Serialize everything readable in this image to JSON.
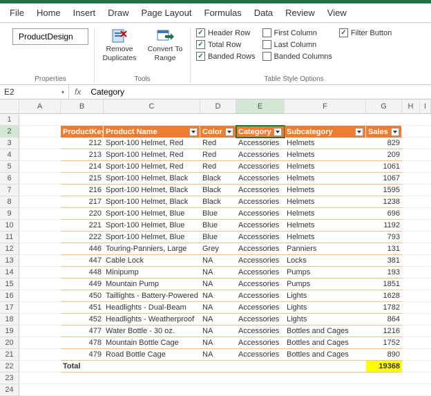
{
  "menu": [
    "File",
    "Home",
    "Insert",
    "Draw",
    "Page Layout",
    "Formulas",
    "Data",
    "Review",
    "View"
  ],
  "ribbon": {
    "tableName": "ProductDesign",
    "propertiesLabel": "Properties",
    "toolsLabel": "Tools",
    "tableStyleLabel": "Table Style Options",
    "removeDup": "Remove Duplicates",
    "convertRange": "Convert To Range",
    "opts": {
      "headerRow": "Header Row",
      "totalRow": "Total Row",
      "bandedRows": "Banded Rows",
      "firstCol": "First Column",
      "lastCol": "Last Column",
      "bandedCols": "Banded Columns",
      "filterBtn": "Filter Button"
    }
  },
  "nameBox": "E2",
  "formulaBar": "Category",
  "colHeaders": [
    "A",
    "B",
    "C",
    "D",
    "E",
    "F",
    "G",
    "H",
    "I"
  ],
  "rowHeaders": [
    "1",
    "2",
    "3",
    "4",
    "5",
    "6",
    "7",
    "8",
    "9",
    "10",
    "11",
    "12",
    "13",
    "14",
    "15",
    "16",
    "17",
    "18",
    "19",
    "20",
    "21",
    "22",
    "23",
    "24"
  ],
  "tableHeaders": [
    "ProductKey",
    "Product Name",
    "Color",
    "Category",
    "Subcategory",
    "Sales"
  ],
  "rows": [
    {
      "key": "212",
      "name": "Sport-100 Helmet, Red",
      "color": "Red",
      "cat": "Accessories",
      "sub": "Helmets",
      "sales": "829"
    },
    {
      "key": "213",
      "name": "Sport-100 Helmet, Red",
      "color": "Red",
      "cat": "Accessories",
      "sub": "Helmets",
      "sales": "209"
    },
    {
      "key": "214",
      "name": "Sport-100 Helmet, Red",
      "color": "Red",
      "cat": "Accessories",
      "sub": "Helmets",
      "sales": "1061"
    },
    {
      "key": "215",
      "name": "Sport-100 Helmet, Black",
      "color": "Black",
      "cat": "Accessories",
      "sub": "Helmets",
      "sales": "1067"
    },
    {
      "key": "216",
      "name": "Sport-100 Helmet, Black",
      "color": "Black",
      "cat": "Accessories",
      "sub": "Helmets",
      "sales": "1595"
    },
    {
      "key": "217",
      "name": "Sport-100 Helmet, Black",
      "color": "Black",
      "cat": "Accessories",
      "sub": "Helmets",
      "sales": "1238"
    },
    {
      "key": "220",
      "name": "Sport-100 Helmet, Blue",
      "color": "Blue",
      "cat": "Accessories",
      "sub": "Helmets",
      "sales": "696"
    },
    {
      "key": "221",
      "name": "Sport-100 Helmet, Blue",
      "color": "Blue",
      "cat": "Accessories",
      "sub": "Helmets",
      "sales": "1192"
    },
    {
      "key": "222",
      "name": "Sport-100 Helmet, Blue",
      "color": "Blue",
      "cat": "Accessories",
      "sub": "Helmets",
      "sales": "793"
    },
    {
      "key": "446",
      "name": "Touring-Panniers, Large",
      "color": "Grey",
      "cat": "Accessories",
      "sub": "Panniers",
      "sales": "131"
    },
    {
      "key": "447",
      "name": "Cable Lock",
      "color": "NA",
      "cat": "Accessories",
      "sub": "Locks",
      "sales": "381"
    },
    {
      "key": "448",
      "name": "Minipump",
      "color": "NA",
      "cat": "Accessories",
      "sub": "Pumps",
      "sales": "193"
    },
    {
      "key": "449",
      "name": "Mountain Pump",
      "color": "NA",
      "cat": "Accessories",
      "sub": "Pumps",
      "sales": "1851"
    },
    {
      "key": "450",
      "name": "Taillights - Battery-Powered",
      "color": "NA",
      "cat": "Accessories",
      "sub": "Lights",
      "sales": "1628"
    },
    {
      "key": "451",
      "name": "Headlights - Dual-Beam",
      "color": "NA",
      "cat": "Accessories",
      "sub": "Lights",
      "sales": "1782"
    },
    {
      "key": "452",
      "name": "Headlights - Weatherproof",
      "color": "NA",
      "cat": "Accessories",
      "sub": "Lights",
      "sales": "864"
    },
    {
      "key": "477",
      "name": "Water Bottle - 30 oz.",
      "color": "NA",
      "cat": "Accessories",
      "sub": "Bottles and Cages",
      "sales": "1216"
    },
    {
      "key": "478",
      "name": "Mountain Bottle Cage",
      "color": "NA",
      "cat": "Accessories",
      "sub": "Bottles and Cages",
      "sales": "1752"
    },
    {
      "key": "479",
      "name": "Road Bottle Cage",
      "color": "NA",
      "cat": "Accessories",
      "sub": "Bottles and Cages",
      "sales": "890"
    }
  ],
  "totalLabel": "Total",
  "totalValue": "19368"
}
